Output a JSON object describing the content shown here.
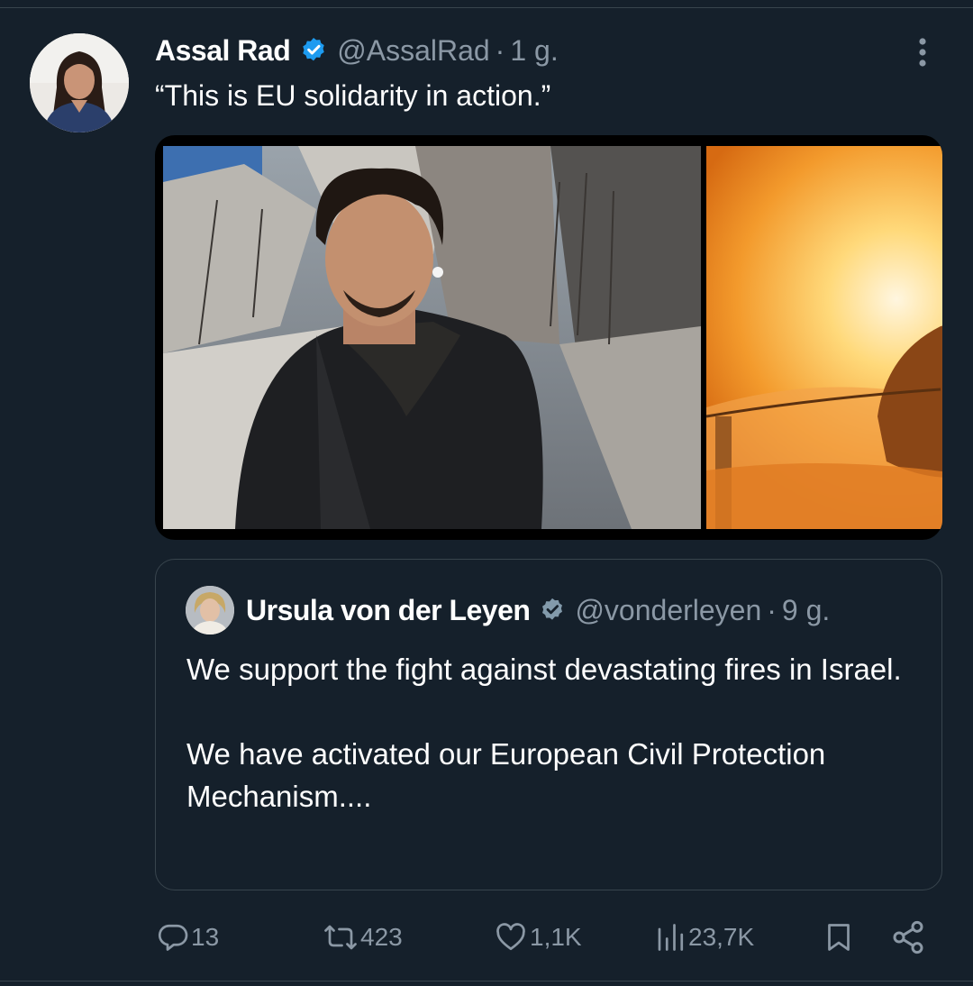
{
  "tweet": {
    "author_name": "Assal Rad",
    "handle": "@AssalRad",
    "separator": "·",
    "time": "1 g.",
    "text": "“This is EU solidarity in action.”"
  },
  "quote": {
    "author_name": "Ursula von der Leyen",
    "handle": "@vonderleyen",
    "separator": "·",
    "time": "9 g.",
    "paragraphs": [
      "We support the fight against devastating fires in Israel.",
      "We have activated our European Civil Protection Mechanism...."
    ]
  },
  "actions": {
    "replies": "13",
    "reposts": "423",
    "likes": "1,1K",
    "views": "23,7K"
  },
  "icons": [
    "verified-icon",
    "more-icon",
    "reply-icon",
    "repost-icon",
    "like-icon",
    "views-icon",
    "bookmark-icon",
    "share-icon"
  ],
  "colors": {
    "background": "#15202b",
    "text": "#ffffff",
    "secondary": "#8b98a5",
    "border": "#38444d",
    "verified": "#1d9bf0"
  }
}
